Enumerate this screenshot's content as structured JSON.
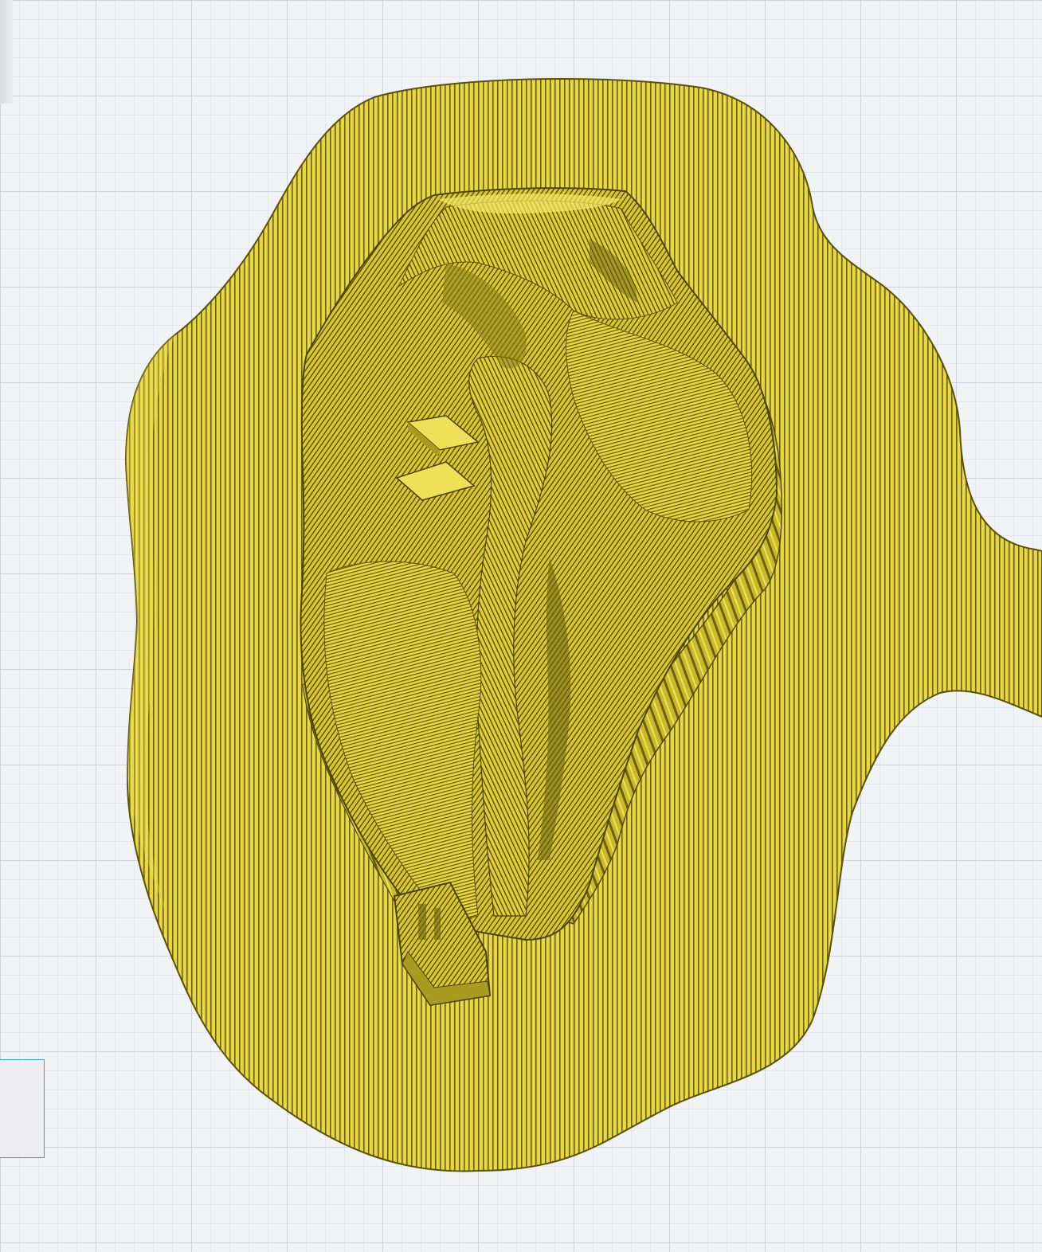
{
  "viewport": {
    "label": "",
    "view_mode": "layer-preview",
    "icon": "build-plate-grid"
  },
  "colors": {
    "background": "#f2f3f5",
    "grid_minor": "#d7dbe2",
    "grid_major": "#b9c0cb",
    "model_fill": "#e3d43a",
    "model_line": "#6d6212",
    "model_highlight": "#f2e65a",
    "model_shadow": "#bcae24",
    "panel_border": "#2aa9d6",
    "panel_fill": "#ececf1"
  },
  "model": {
    "name": "",
    "material": "",
    "visible": true
  },
  "side_panel": {
    "label": "",
    "collapsed": true
  }
}
